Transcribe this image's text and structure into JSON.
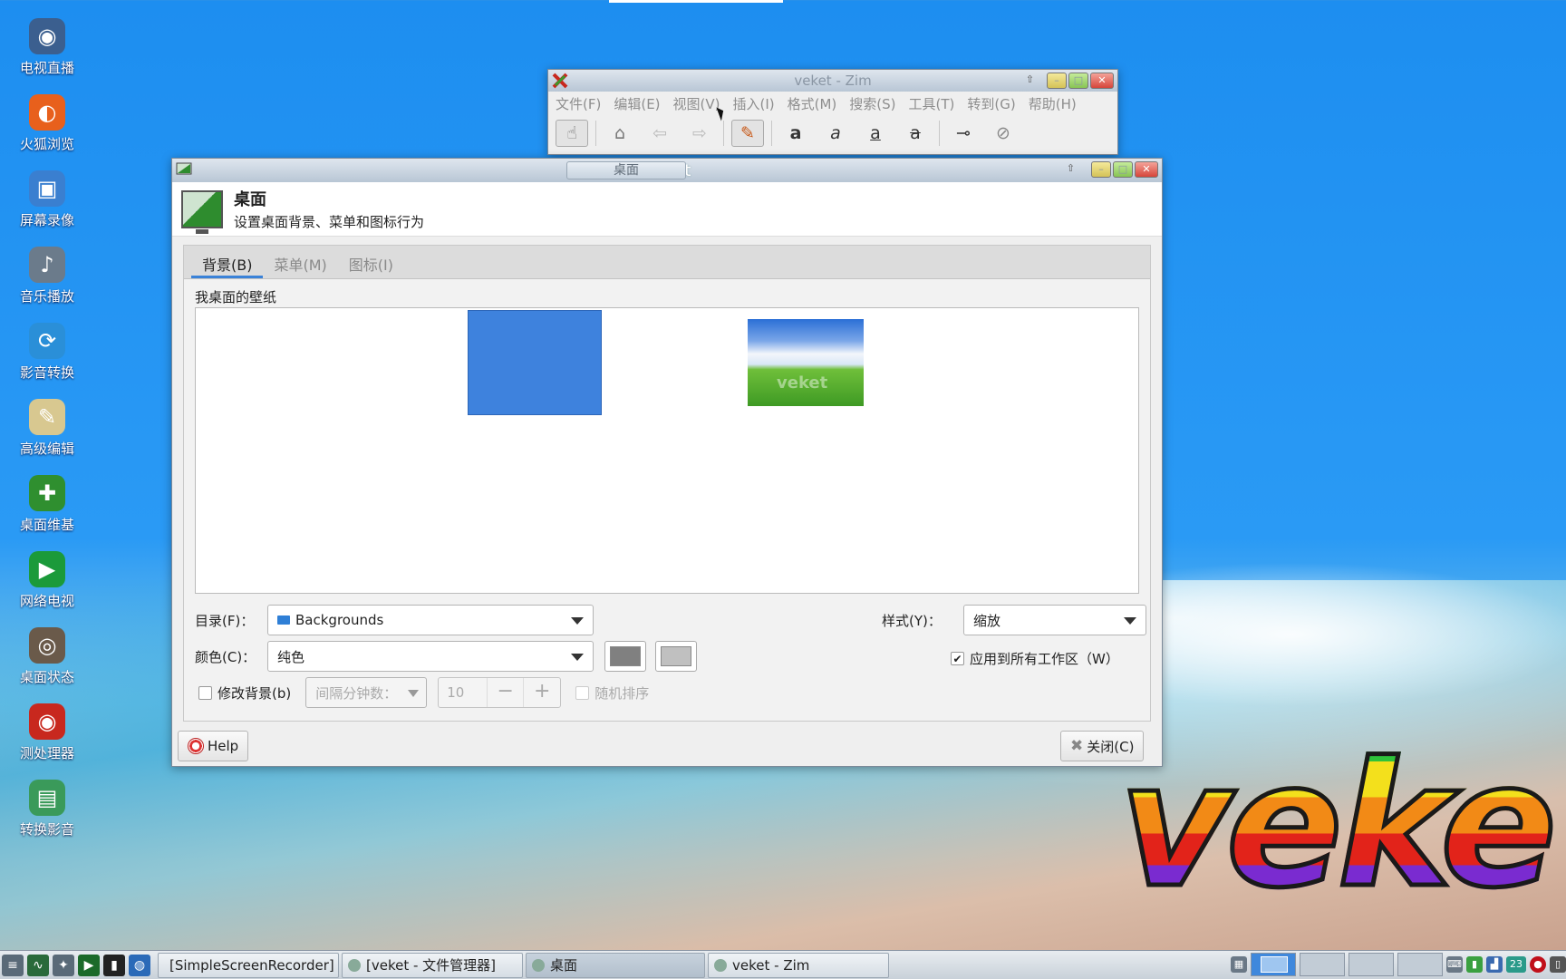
{
  "desktop": {
    "icons": [
      {
        "label": "电视直播",
        "icon": "tv-icon",
        "color": "#3b5f8f",
        "glyph": "◉"
      },
      {
        "label": "火狐浏览",
        "icon": "firefox-icon",
        "color": "#e8601c",
        "glyph": "◐"
      },
      {
        "label": "屏幕录像",
        "icon": "screen-record-icon",
        "color": "#3a7fd0",
        "glyph": "▣"
      },
      {
        "label": "音乐播放",
        "icon": "speaker-icon",
        "color": "#6b7b8b",
        "glyph": "♪"
      },
      {
        "label": "影音转换",
        "icon": "video-convert-icon",
        "color": "#2a8fd8",
        "glyph": "⟳"
      },
      {
        "label": "高级编辑",
        "icon": "text-editor-icon",
        "color": "#d8c890",
        "glyph": "✎"
      },
      {
        "label": "桌面维基",
        "icon": "zim-wiki-icon",
        "color": "#2f8f2f",
        "glyph": "✚"
      },
      {
        "label": "网络电视",
        "icon": "play-icon",
        "color": "#1b9a3a",
        "glyph": "▶"
      },
      {
        "label": "桌面状态",
        "icon": "status-icon",
        "color": "#6a5a4a",
        "glyph": "◎"
      },
      {
        "label": "测处理器",
        "icon": "cpu-test-icon",
        "color": "#c8281e",
        "glyph": "◉"
      },
      {
        "label": "转换影音",
        "icon": "media-convert-icon",
        "color": "#3a9a5a",
        "glyph": "▤"
      }
    ],
    "logo_text": "veke"
  },
  "zim": {
    "title": "veket - Zim",
    "menu": [
      "文件(F)",
      "编辑(E)",
      "视图(V)",
      "插入(I)",
      "格式(M)",
      "搜索(S)",
      "工具(T)",
      "转到(G)",
      "帮助(H)"
    ],
    "toolbar_icons": [
      "pin-icon",
      "home-icon",
      "back-icon",
      "forward-icon",
      "edit-icon",
      "bold-icon",
      "italic-icon",
      "underline-icon",
      "strike-icon",
      "link-icon",
      "attach-icon"
    ]
  },
  "desktop_window": {
    "tab_title": "桌面",
    "title": "veket",
    "header_title": "桌面",
    "header_subtitle": "设置桌面背景、菜单和图标行为",
    "tabs": [
      "背景(B)",
      "菜单(M)",
      "图标(I)"
    ],
    "active_tab": 0,
    "section_label": "我桌面的壁纸",
    "thumb_watermark": "veket",
    "directory_label": "目录(F)：",
    "directory_value": "Backgrounds",
    "style_label": "样式(Y)：",
    "style_value": "缩放",
    "color_label": "颜色(C)：",
    "color_value": "纯色",
    "color_primary": "#808080",
    "color_secondary": "#c0c0c0",
    "apply_all_label": "应用到所有工作区（W）",
    "apply_all_checked": true,
    "change_bg_label": "修改背景(b)",
    "change_bg_checked": false,
    "interval_label": "间隔分钟数：",
    "interval_value": "10",
    "random_label": "随机排序",
    "random_checked": false,
    "help_label": "Help",
    "close_label": "关闭(C)"
  },
  "taskbar": {
    "tasks": [
      {
        "label": "[SimpleScreenRecorder]",
        "active": false
      },
      {
        "label": "[veket - 文件管理器]",
        "active": false
      },
      {
        "label": "桌面",
        "active": true
      },
      {
        "label": "veket - Zim",
        "active": false
      }
    ],
    "tray_number": "23"
  }
}
